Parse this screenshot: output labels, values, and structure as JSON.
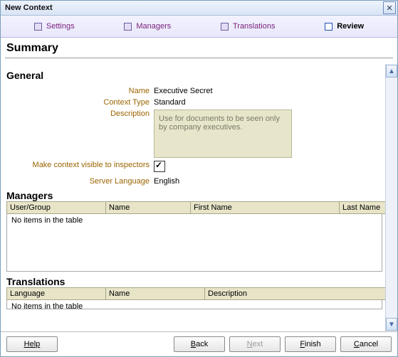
{
  "window": {
    "title": "New Context"
  },
  "steps": {
    "settings": "Settings",
    "managers": "Managers",
    "translations": "Translations",
    "review": "Review"
  },
  "summary": {
    "title": "Summary"
  },
  "general": {
    "title": "General",
    "labels": {
      "name": "Name",
      "context_type": "Context Type",
      "description": "Description",
      "visible": "Make context visible to inspectors",
      "server_language": "Server Language"
    },
    "values": {
      "name": "Executive Secret",
      "context_type": "Standard",
      "description": "Use for documents to be seen only by company executives.",
      "visible_checked": true,
      "server_language": "English"
    }
  },
  "managers": {
    "title": "Managers",
    "columns": {
      "user_group": "User/Group",
      "name": "Name",
      "first_name": "First Name",
      "last_name": "Last Name"
    },
    "empty": "No items in the table",
    "rows": []
  },
  "translations": {
    "title": "Translations",
    "columns": {
      "language": "Language",
      "name": "Name",
      "description": "Description"
    },
    "empty": "No items in the table",
    "rows": []
  },
  "buttons": {
    "help": "Help",
    "back": "Back",
    "next": "Next",
    "finish": "Finish",
    "cancel": "Cancel"
  }
}
